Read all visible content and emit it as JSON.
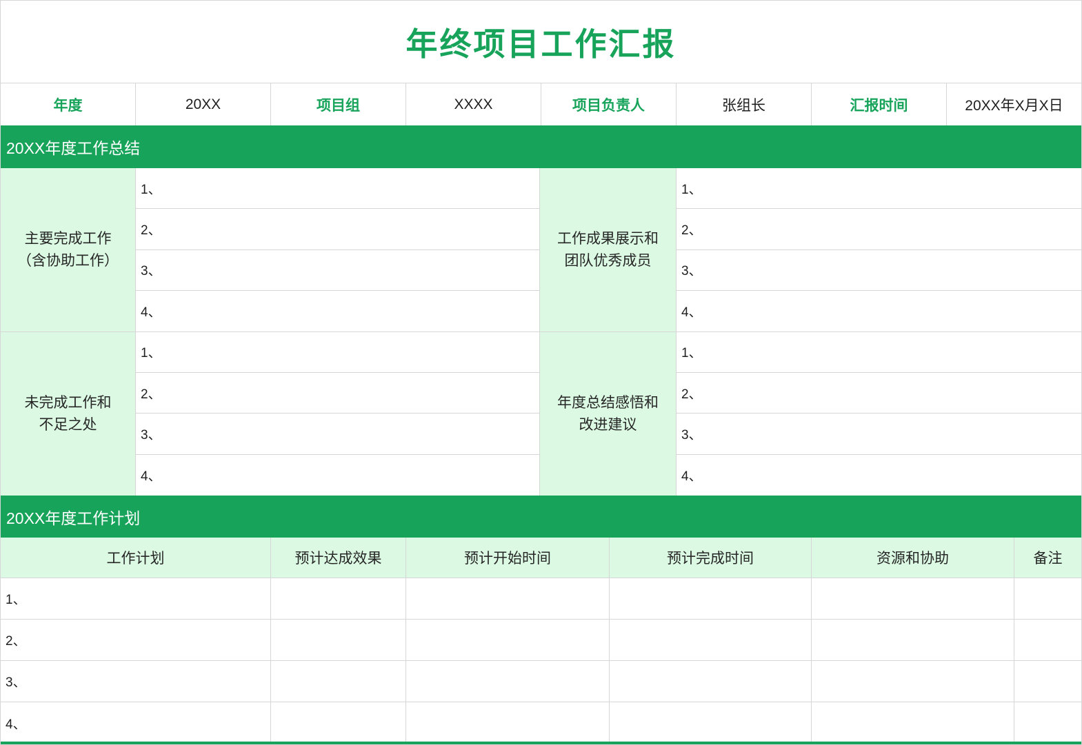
{
  "title": "年终项目工作汇报",
  "colors": {
    "accent_green": "#17a45a",
    "light_green": "#dcfae3",
    "border_gray": "#d6d6d6"
  },
  "info_row": {
    "year_label": "年度",
    "year_value": "20XX",
    "group_label": "项目组",
    "group_value": "XXXX",
    "leader_label": "项目负责人",
    "leader_value": "张组长",
    "time_label": "汇报时间",
    "time_value": "20XX年X月X日"
  },
  "summary": {
    "bar_title": "20XX年度工作总结",
    "blocks": [
      {
        "label": "主要完成工作\n（含协助工作）",
        "items": [
          "1、",
          "2、",
          "3、",
          "4、"
        ]
      },
      {
        "label": "工作成果展示和\n团队优秀成员",
        "items": [
          "1、",
          "2、",
          "3、",
          "4、"
        ]
      },
      {
        "label": "未完成工作和\n不足之处",
        "items": [
          "1、",
          "2、",
          "3、",
          "4、"
        ]
      },
      {
        "label": "年度总结感悟和\n改进建议",
        "items": [
          "1、",
          "2、",
          "3、",
          "4、"
        ]
      }
    ]
  },
  "plan": {
    "bar_title": "20XX年度工作计划",
    "headers": [
      "工作计划",
      "预计达成效果",
      "预计开始时间",
      "预计完成时间",
      "资源和协助",
      "备注"
    ],
    "row_numbers": [
      "1、",
      "2、",
      "3、",
      "4、"
    ]
  }
}
